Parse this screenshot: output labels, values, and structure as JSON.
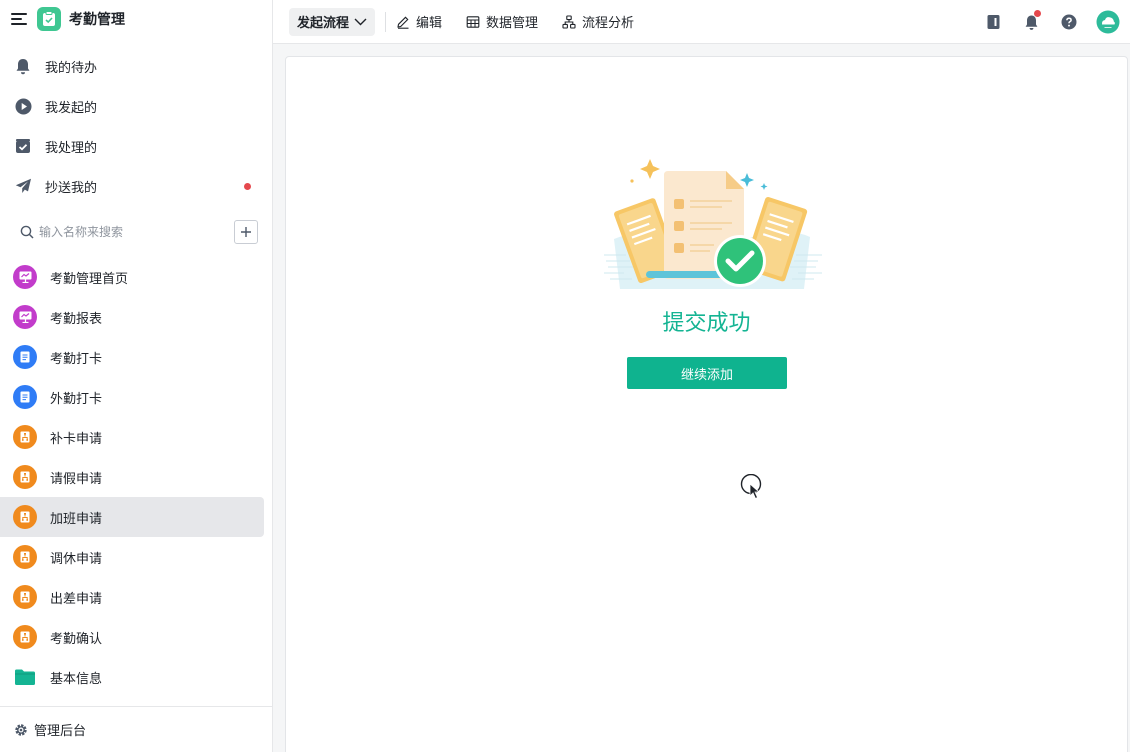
{
  "app": {
    "title": "考勤管理"
  },
  "nav": {
    "items": [
      {
        "label": "我的待办",
        "icon": "bell-icon"
      },
      {
        "label": "我发起的",
        "icon": "play-circle-icon"
      },
      {
        "label": "我处理的",
        "icon": "task-check-icon"
      },
      {
        "label": "抄送我的",
        "icon": "send-icon",
        "unread": true
      }
    ]
  },
  "search": {
    "placeholder": "输入名称来搜索",
    "value": ""
  },
  "pages": [
    {
      "label": "考勤管理首页",
      "icon": "dashboard-icon",
      "color": "#c23ccb"
    },
    {
      "label": "考勤报表",
      "icon": "dashboard-icon",
      "color": "#c23ccb"
    },
    {
      "label": "考勤打卡",
      "icon": "form-icon",
      "color": "#2f7cf6"
    },
    {
      "label": "外勤打卡",
      "icon": "form-icon",
      "color": "#2f7cf6"
    },
    {
      "label": "补卡申请",
      "icon": "flow-icon",
      "color": "#f08a1d"
    },
    {
      "label": "请假申请",
      "icon": "flow-icon",
      "color": "#f08a1d"
    },
    {
      "label": "加班申请",
      "icon": "flow-icon",
      "color": "#f08a1d",
      "active": true
    },
    {
      "label": "调休申请",
      "icon": "flow-icon",
      "color": "#f08a1d"
    },
    {
      "label": "出差申请",
      "icon": "flow-icon",
      "color": "#f08a1d"
    },
    {
      "label": "考勤确认",
      "icon": "flow-icon",
      "color": "#f08a1d"
    },
    {
      "label": "基本信息",
      "icon": "folder-icon",
      "color": "#14b493"
    }
  ],
  "footer": {
    "label": "管理后台"
  },
  "toolbar": {
    "flow_label": "发起流程",
    "edit_label": "编辑",
    "data_label": "数据管理",
    "analysis_label": "流程分析"
  },
  "main": {
    "success_title": "提交成功",
    "continue_label": "继续添加"
  },
  "colors": {
    "accent": "#14b493",
    "button": "#0fb38f",
    "notification": "#e5484d"
  }
}
